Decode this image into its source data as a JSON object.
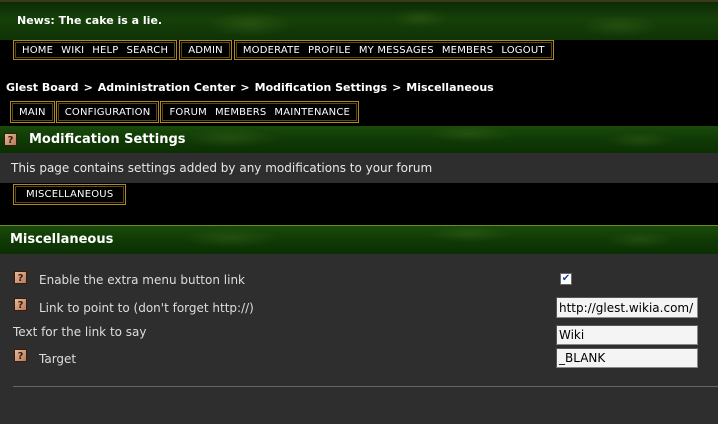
{
  "news": {
    "label": "News:",
    "text": "The cake is a lie."
  },
  "top_menu": {
    "group1": [
      "HOME",
      "WIKI",
      "HELP",
      "SEARCH"
    ],
    "group2": [
      "ADMIN"
    ],
    "group3": [
      "MODERATE",
      "PROFILE",
      "MY MESSAGES",
      "MEMBERS",
      "LOGOUT"
    ]
  },
  "breadcrumb": [
    "Glest Board",
    "Administration Center",
    "Modification Settings",
    "Miscellaneous"
  ],
  "breadcrumb_sep": ">",
  "admin_menu": {
    "main": "MAIN",
    "configuration": "CONFIGURATION",
    "rest": [
      "FORUM",
      "MEMBERS",
      "MAINTENANCE"
    ]
  },
  "mod_settings": {
    "title": "Modification Settings",
    "description": "This page contains settings added by any modifications to your forum",
    "subtab": "MISCELLANEOUS"
  },
  "misc": {
    "title": "Miscellaneous",
    "fields": {
      "extra_menu_label": "Enable the extra menu button link",
      "extra_menu_checked": true,
      "link_label": "Link to point to (don't forget http://)",
      "link_value": "http://glest.wikia.com/",
      "text_label": "Text for the link to say",
      "text_value": "Wiki",
      "target_label": "Target",
      "target_value": "_BLANK"
    }
  },
  "icons": {
    "help": "help-question-icon",
    "check": "checkmark-icon"
  }
}
